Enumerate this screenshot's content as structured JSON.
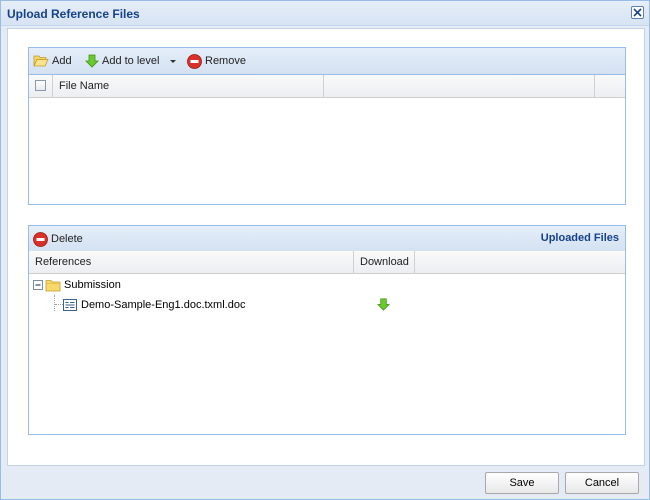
{
  "dialog": {
    "title": "Upload Reference Files"
  },
  "upload_panel": {
    "toolbar": {
      "add": "Add",
      "add_to_level": "Add to level",
      "remove": "Remove"
    },
    "columns": [
      "File Name",
      "",
      ""
    ]
  },
  "uploaded_panel": {
    "toolbar": {
      "delete": "Delete",
      "heading": "Uploaded Files"
    },
    "columns": [
      "References",
      "Download",
      ""
    ],
    "tree": {
      "folder": "Submission",
      "file": "Demo-Sample-Eng1.doc.txml.doc"
    }
  },
  "footer": {
    "save": "Save",
    "cancel": "Cancel"
  },
  "icons": {
    "add": "folder-open-icon",
    "add_to_level": "green-down-arrow-icon",
    "remove": "red-stop-icon",
    "delete": "red-stop-icon",
    "collapse": "tree-minus-icon",
    "folder": "folder-icon",
    "file": "document-icon",
    "download": "download-arrow-icon",
    "close": "close-icon"
  }
}
